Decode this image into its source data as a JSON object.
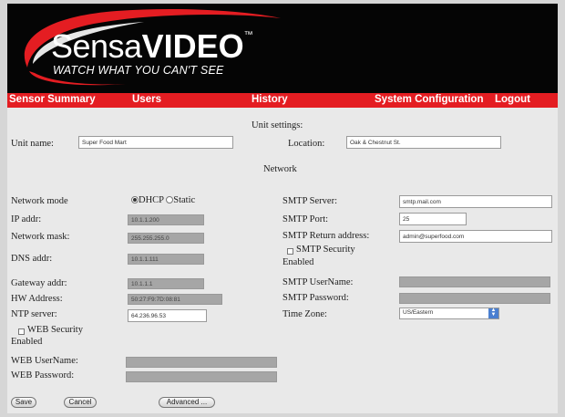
{
  "brand": {
    "logo_text_light": "Sensa",
    "logo_text_bold": "VIDEO",
    "trademark": "™",
    "tagline": "WATCH WHAT YOU CAN'T SEE",
    "accent_color": "#e41d22"
  },
  "nav": {
    "items": [
      "Sensor Summary",
      "Users",
      "History",
      "System Configuration",
      "Logout"
    ]
  },
  "unit_settings": {
    "heading": "Unit settings:",
    "unit_name_label": "Unit name:",
    "unit_name_value": "Super Food Mart",
    "location_label": "Location:",
    "location_value": "Oak & Chestnut St."
  },
  "network": {
    "heading": "Network",
    "mode_label": "Network mode",
    "mode_options": [
      "DHCP",
      "Static"
    ],
    "mode_selected": "DHCP",
    "ip_label": "IP addr:",
    "ip_value": "10.1.1.200",
    "mask_label": "Network mask:",
    "mask_value": "255.255.255.0",
    "dns_label": "DNS addr:",
    "dns_value": "10.1.1.111",
    "gateway_label": "Gateway addr:",
    "gateway_value": "10.1.1.1",
    "hw_label": "HW Address:",
    "hw_value": "50:27:F9:7D:08:81",
    "ntp_label": "NTP server:",
    "ntp_value": "64.236.96.53",
    "web_security_label_line1": "WEB Security",
    "web_security_label_line2": "Enabled",
    "web_username_label": "WEB UserName:",
    "web_username_value": "",
    "web_password_label": "WEB Password:",
    "web_password_value": ""
  },
  "smtp": {
    "server_label": "SMTP Server:",
    "server_value": "smtp.mail.com",
    "port_label": "SMTP Port:",
    "port_value": "25",
    "return_label": "SMTP Return address:",
    "return_value": "admin@superfood.com",
    "security_label_line1": "SMTP Security",
    "security_label_line2": "Enabled",
    "username_label": "SMTP UserName:",
    "username_value": "",
    "password_label": "SMTP Password:",
    "password_value": "",
    "timezone_label": "Time Zone:",
    "timezone_value": "US/Eastern"
  },
  "buttons": {
    "save": "Save",
    "cancel": "Cancel",
    "advanced": "Advanced ..."
  }
}
